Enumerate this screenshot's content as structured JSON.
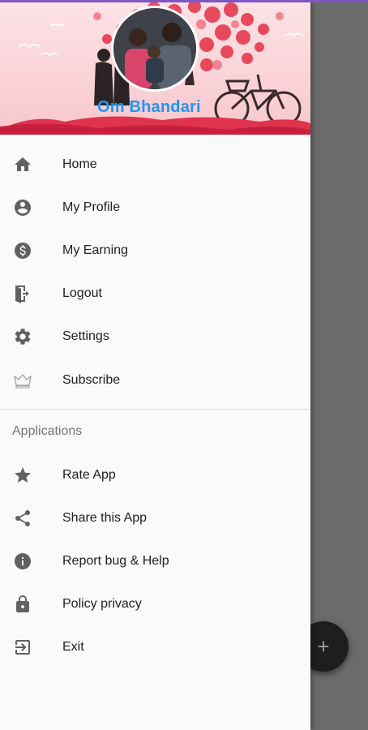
{
  "header": {
    "user_name": "Om Bhandari"
  },
  "menu": [
    {
      "label": "Home",
      "icon": "home-icon"
    },
    {
      "label": "My Profile",
      "icon": "account-circle-icon"
    },
    {
      "label": "My Earning",
      "icon": "dollar-circle-icon"
    },
    {
      "label": "Logout",
      "icon": "logout-door-icon"
    },
    {
      "label": "Settings",
      "icon": "gear-icon"
    },
    {
      "label": "Subscribe",
      "icon": "crown-icon"
    }
  ],
  "applications": {
    "title": "Applications",
    "items": [
      {
        "label": "Rate App",
        "icon": "star-icon"
      },
      {
        "label": "Share this App",
        "icon": "share-icon"
      },
      {
        "label": "Report bug & Help",
        "icon": "info-icon"
      },
      {
        "label": "Policy privacy",
        "icon": "lock-icon"
      },
      {
        "label": "Exit",
        "icon": "exit-icon"
      }
    ]
  },
  "fab": {
    "icon": "plus-icon"
  },
  "colors": {
    "accent_name": "#2196f3",
    "icon_gray": "#616161",
    "scrim": "#6b6b6b"
  }
}
